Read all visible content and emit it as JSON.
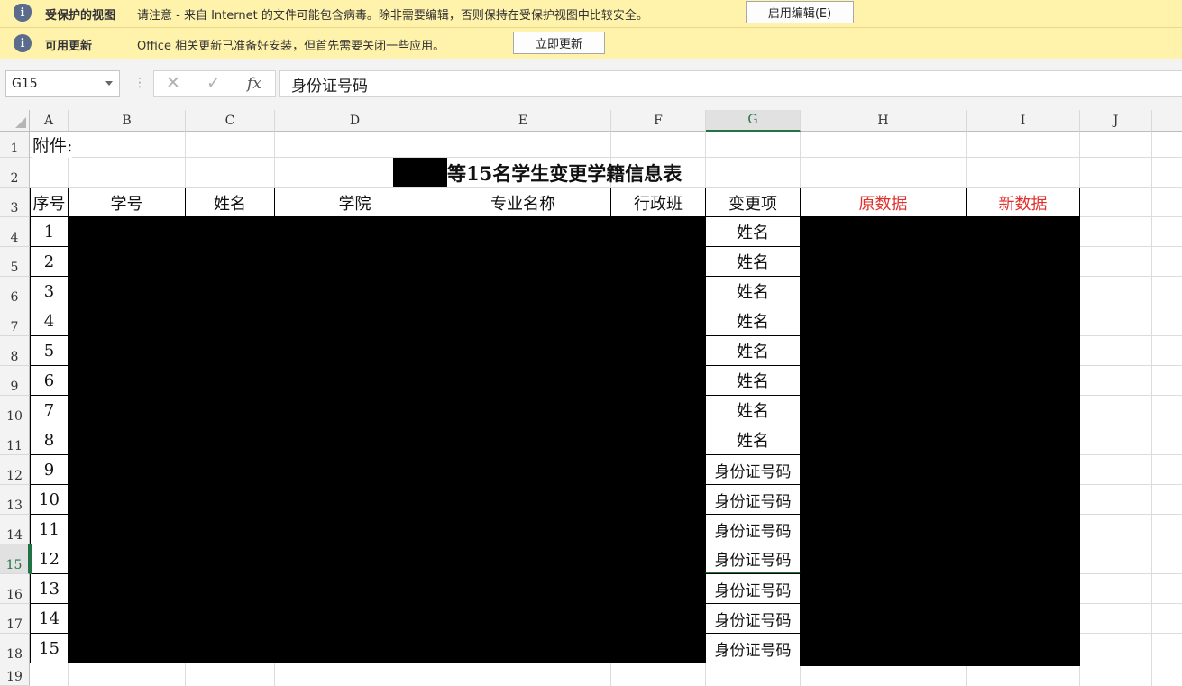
{
  "protected_bar": {
    "title": "受保护的视图",
    "message": "请注意 - 来自 Internet 的文件可能包含病毒。除非需要编辑，否则保持在受保护视图中比较安全。",
    "button": "启用编辑(E)"
  },
  "update_bar": {
    "title": "可用更新",
    "message": "Office 相关更新已准备好安装，但首先需要关闭一些应用。",
    "button": "立即更新"
  },
  "formula_bar": {
    "name_box": "G15",
    "formula": "身份证号码",
    "fx_label": "fx"
  },
  "columns": [
    "A",
    "B",
    "C",
    "D",
    "E",
    "F",
    "G",
    "H",
    "I",
    "J"
  ],
  "rows": [
    "1",
    "2",
    "3",
    "4",
    "5",
    "6",
    "7",
    "8",
    "9",
    "10",
    "11",
    "12",
    "13",
    "14",
    "15",
    "16",
    "17",
    "18",
    "19"
  ],
  "selected_cell": "G15",
  "sheet": {
    "attachment_label": "附件:",
    "title_suffix": "等15名学生变更学籍信息表",
    "headers": [
      "序号",
      "学号",
      "姓名",
      "学院",
      "专业名称",
      "行政班",
      "变更项",
      "原数据",
      "新数据"
    ],
    "records": [
      {
        "no": "1",
        "change": "姓名"
      },
      {
        "no": "2",
        "change": "姓名"
      },
      {
        "no": "3",
        "change": "姓名"
      },
      {
        "no": "4",
        "change": "姓名"
      },
      {
        "no": "5",
        "change": "姓名"
      },
      {
        "no": "6",
        "change": "姓名"
      },
      {
        "no": "7",
        "change": "姓名"
      },
      {
        "no": "8",
        "change": "姓名"
      },
      {
        "no": "9",
        "change": "身份证号码"
      },
      {
        "no": "10",
        "change": "身份证号码"
      },
      {
        "no": "11",
        "change": "身份证号码"
      },
      {
        "no": "12",
        "change": "身份证号码"
      },
      {
        "no": "13",
        "change": "身份证号码"
      },
      {
        "no": "14",
        "change": "身份证号码"
      },
      {
        "no": "15",
        "change": "身份证号码"
      }
    ]
  },
  "colors": {
    "message_bar": "#fff2ab",
    "header_red": "#e0312c",
    "selection_green": "#217346",
    "redaction": "#000000"
  }
}
